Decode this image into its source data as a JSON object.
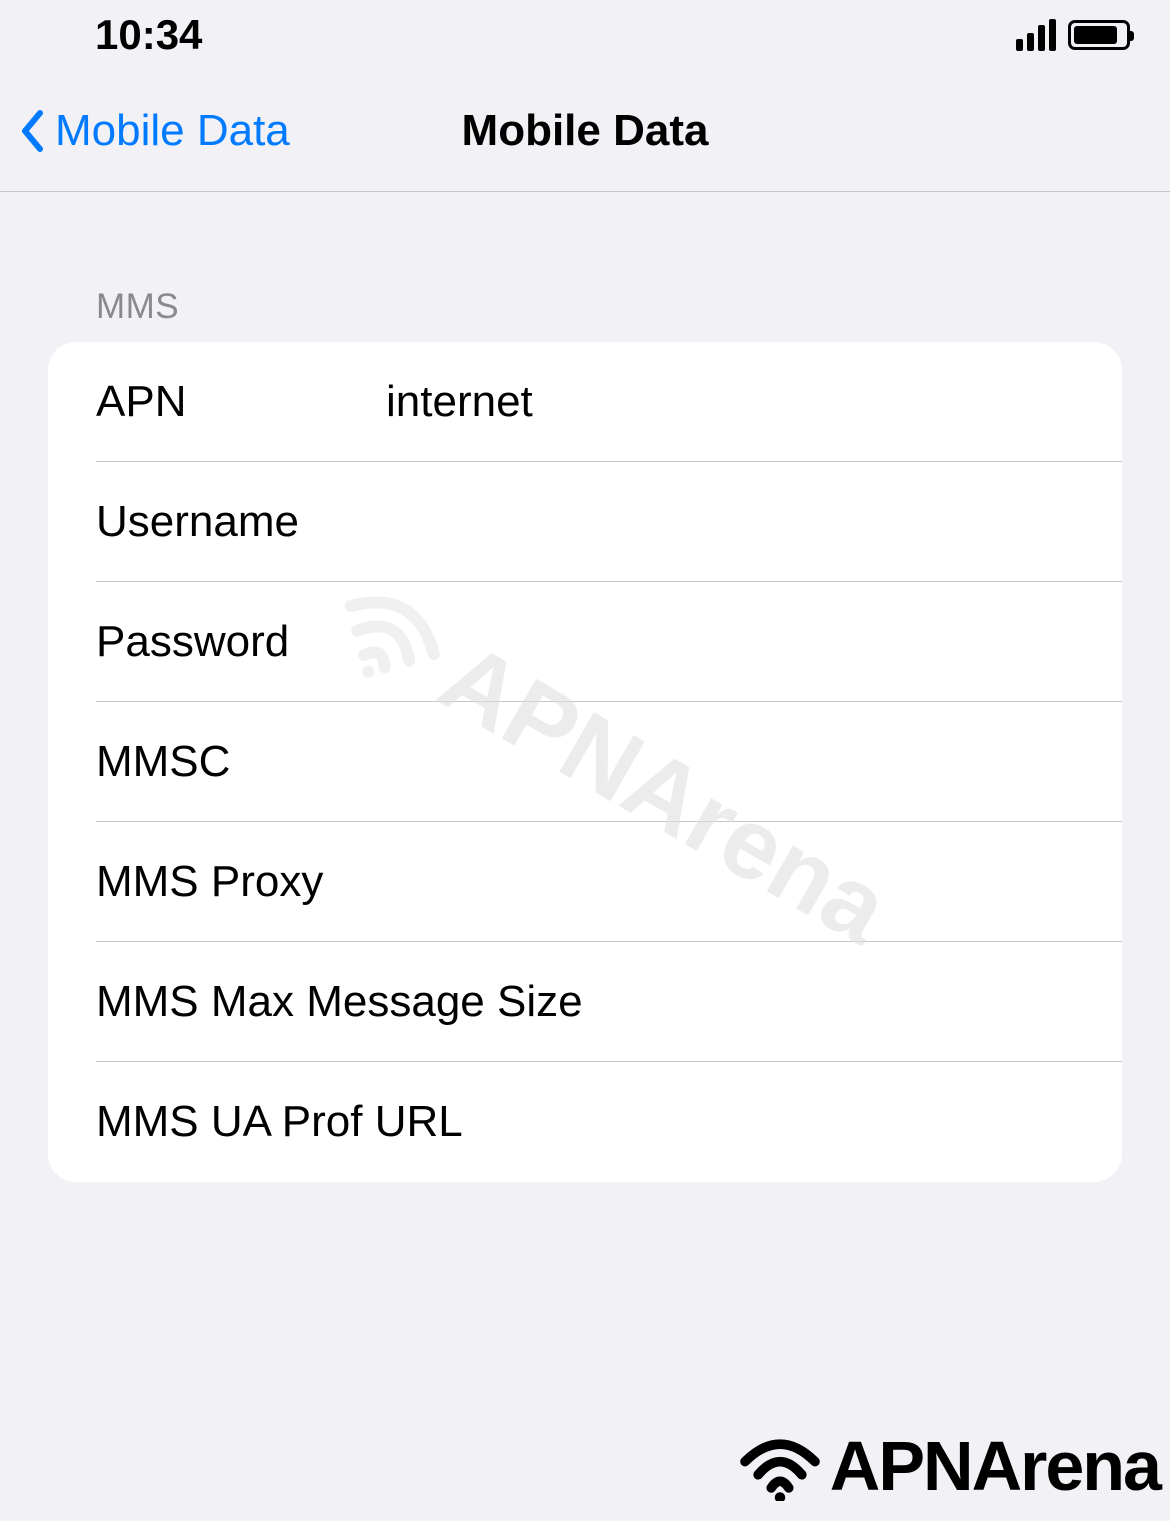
{
  "statusBar": {
    "time": "10:34"
  },
  "navBar": {
    "backLabel": "Mobile Data",
    "title": "Mobile Data"
  },
  "section": {
    "header": "MMS",
    "rows": [
      {
        "label": "APN",
        "value": "internet"
      },
      {
        "label": "Username",
        "value": ""
      },
      {
        "label": "Password",
        "value": ""
      },
      {
        "label": "MMSC",
        "value": ""
      },
      {
        "label": "MMS Proxy",
        "value": ""
      },
      {
        "label": "MMS Max Message Size",
        "value": ""
      },
      {
        "label": "MMS UA Prof URL",
        "value": ""
      }
    ]
  },
  "watermark": "APNArena",
  "footer": "APNArena"
}
